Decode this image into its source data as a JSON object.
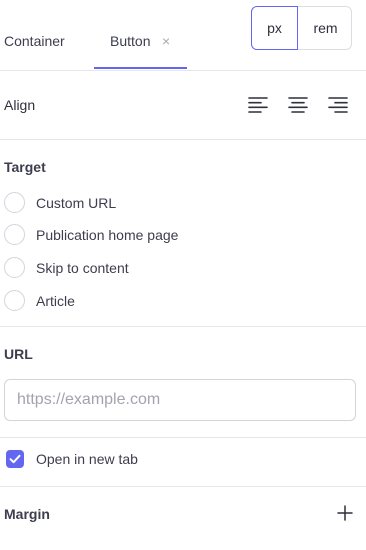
{
  "tabs": {
    "container_label": "Container",
    "button_label": "Button",
    "close_glyph": "×"
  },
  "units": {
    "px": "px",
    "rem": "rem",
    "selected": "px"
  },
  "align": {
    "label": "Align",
    "options": [
      "align-left-icon",
      "align-center-icon",
      "align-right-icon"
    ]
  },
  "target": {
    "title": "Target",
    "options": [
      {
        "label": "Custom URL",
        "selected": false
      },
      {
        "label": "Publication home page",
        "selected": false
      },
      {
        "label": "Skip to content",
        "selected": false
      },
      {
        "label": "Article",
        "selected": false
      }
    ]
  },
  "url": {
    "title": "URL",
    "value": "",
    "placeholder": "https://example.com"
  },
  "new_tab": {
    "label": "Open in new tab",
    "checked": true
  },
  "margin": {
    "title": "Margin",
    "add_icon": "plus-icon"
  },
  "colors": {
    "accent": "#6366f1",
    "border": "#e6e6ea",
    "text": "#3d3d4e"
  }
}
